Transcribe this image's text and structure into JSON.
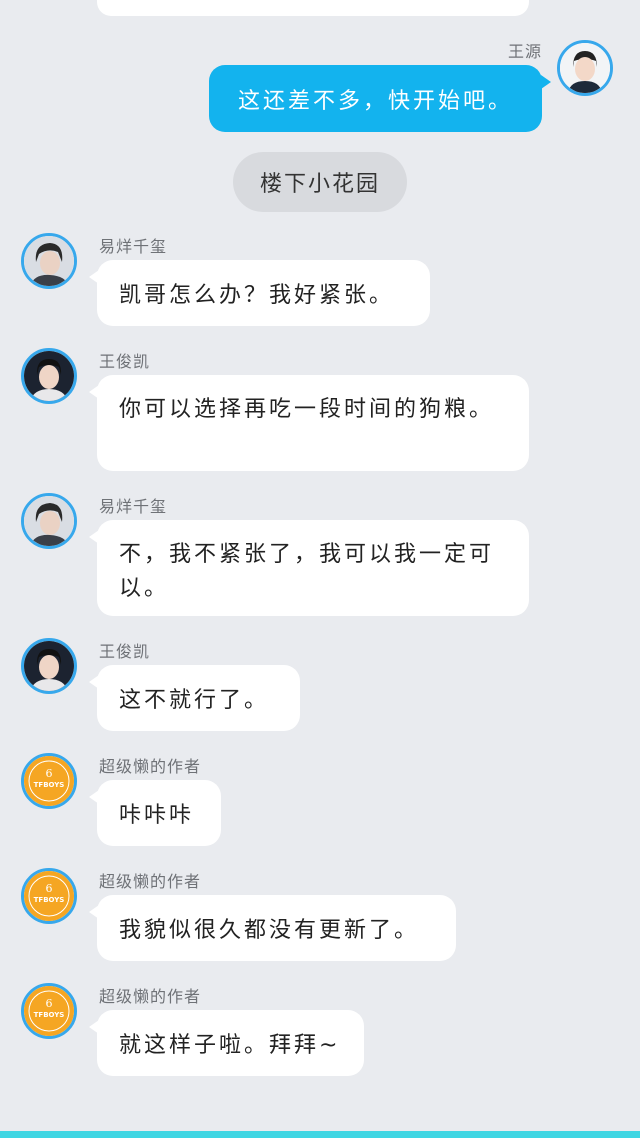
{
  "scene_label": "楼下小花园",
  "messages": [
    {
      "sender": "王源",
      "text": "这还差不多，快开始吧。",
      "self": true
    },
    {
      "sender": "易烊千玺",
      "text": "凯哥怎么办？我好紧张。"
    },
    {
      "sender": "王俊凯",
      "text": "你可以选择再吃一段时间的狗粮。"
    },
    {
      "sender": "易烊千玺",
      "text": "不，我不紧张了，我可以我一定可以。"
    },
    {
      "sender": "王俊凯",
      "text": "这不就行了。"
    },
    {
      "sender": "超级懒的作者",
      "text": "咔咔咔"
    },
    {
      "sender": "超级懒的作者",
      "text": "我貌似很久都没有更新了。"
    },
    {
      "sender": "超级懒的作者",
      "text": "就这样子啦。拜拜~"
    }
  ],
  "logo_text": "TFBOYS",
  "colors": {
    "background": "#e9ebef",
    "self_bubble": "#13b3ee",
    "avatar_border": "#37a8ec",
    "author_avatar": "#f5a623",
    "bottom_bar": "#3fd6e3"
  }
}
